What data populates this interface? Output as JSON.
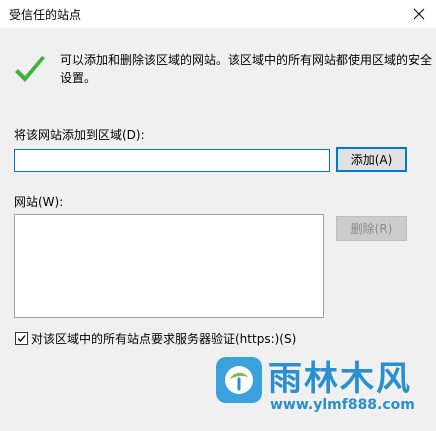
{
  "window": {
    "title": "受信任的站点",
    "close_icon": "close-icon"
  },
  "info": {
    "text": "可以添加和删除该区域的网站。该区域中的所有网站都使用区域的安全设置。",
    "icon": "checkmark-icon"
  },
  "add_site": {
    "label": "将该网站添加到区域(D):",
    "value": "",
    "placeholder": "",
    "button": "添加(A)"
  },
  "sites": {
    "label": "网站(W):",
    "items": [],
    "remove_button": "删除(R)"
  },
  "https_option": {
    "label": "对该区域中的所有站点要求服务器验证(https:)(S)",
    "checked": true
  },
  "watermark": {
    "name": "雨林木风",
    "url": "www.ylmf888.com"
  },
  "colors": {
    "accent": "#0078d7",
    "check_green": "#3db33d",
    "watermark_blue": "#2a8fcf"
  }
}
